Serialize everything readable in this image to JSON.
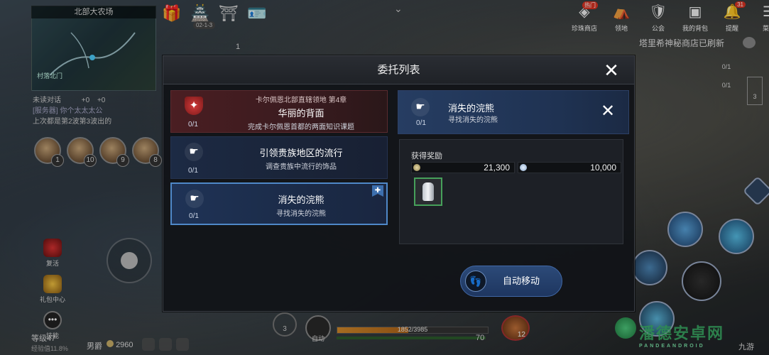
{
  "hud": {
    "map_name": "北部大农场",
    "map_label": "村落北门",
    "chat": {
      "tab_unread": "未读对话",
      "counter_a": "+0",
      "counter_b": "+0",
      "line1": "[服务器] 你个太太太公",
      "line2": "上次都是第2波第3波出的"
    },
    "pets": [
      {
        "level": "1"
      },
      {
        "level": "10"
      },
      {
        "level": "9"
      },
      {
        "level": "8"
      }
    ],
    "left_icons": [
      {
        "label": "复活",
        "icon": "gift-box-icon"
      },
      {
        "label": "礼包中心",
        "icon": "gift-bag-icon"
      },
      {
        "label": "技能",
        "icon": "menu-dots-icon"
      }
    ],
    "level": "等级47",
    "exp": "经验值11.8%",
    "gender": "男爵",
    "silver": "2960",
    "top_progress": "02-1-3",
    "top_num": "1",
    "right_menu": [
      {
        "label": "珍珠商店",
        "icon": "shop-icon",
        "badge": "热门"
      },
      {
        "label": "领地",
        "icon": "tent-icon"
      },
      {
        "label": "公会",
        "icon": "shield-icon"
      },
      {
        "label": "我的背包",
        "icon": "bag-icon"
      },
      {
        "label": "提醒",
        "icon": "bell-icon",
        "badge": "31"
      },
      {
        "label": "菜单",
        "icon": "menu-icon",
        "badge": "4"
      }
    ],
    "shop_notice": "塔里希神秘商店已刷新",
    "right_quests": [
      "0/1",
      "0/1"
    ],
    "side_count": "3",
    "skill_cd": "3",
    "auto_label": "自动",
    "hp_text": "1852/3985",
    "hp_ratio": 0.47,
    "mp_value": "70",
    "potion_count": "12",
    "watermark": "潘德安卓网",
    "watermark_sub": "PANDEANDROID",
    "brand": "九游"
  },
  "modal": {
    "title": "委托列表",
    "quests": [
      {
        "chapter": "卡尔佩恩北部直辖领地 第4章",
        "title": "华丽的背面",
        "desc": "完成卡尔佩恩首都的两面知识课题",
        "count": "0/1",
        "icon": "crest-icon",
        "style": "red"
      },
      {
        "title": "引领贵族地区的流行",
        "desc": "调查贵族中流行的饰品",
        "count": "0/1",
        "icon": "hand-icon",
        "style": "blue"
      },
      {
        "title": "消失的浣熊",
        "desc": "寻找消失的浣熊",
        "count": "0/1",
        "icon": "hand-icon",
        "style": "selected",
        "pinned": true
      }
    ],
    "detail": {
      "title": "消失的浣熊",
      "desc": "寻找消失的浣熊",
      "count": "0/1",
      "reward_label": "获得奖励",
      "silver": "21,300",
      "exp": "10,000",
      "item_icon": "milk-can-icon",
      "auto_move": "自动移动"
    }
  }
}
